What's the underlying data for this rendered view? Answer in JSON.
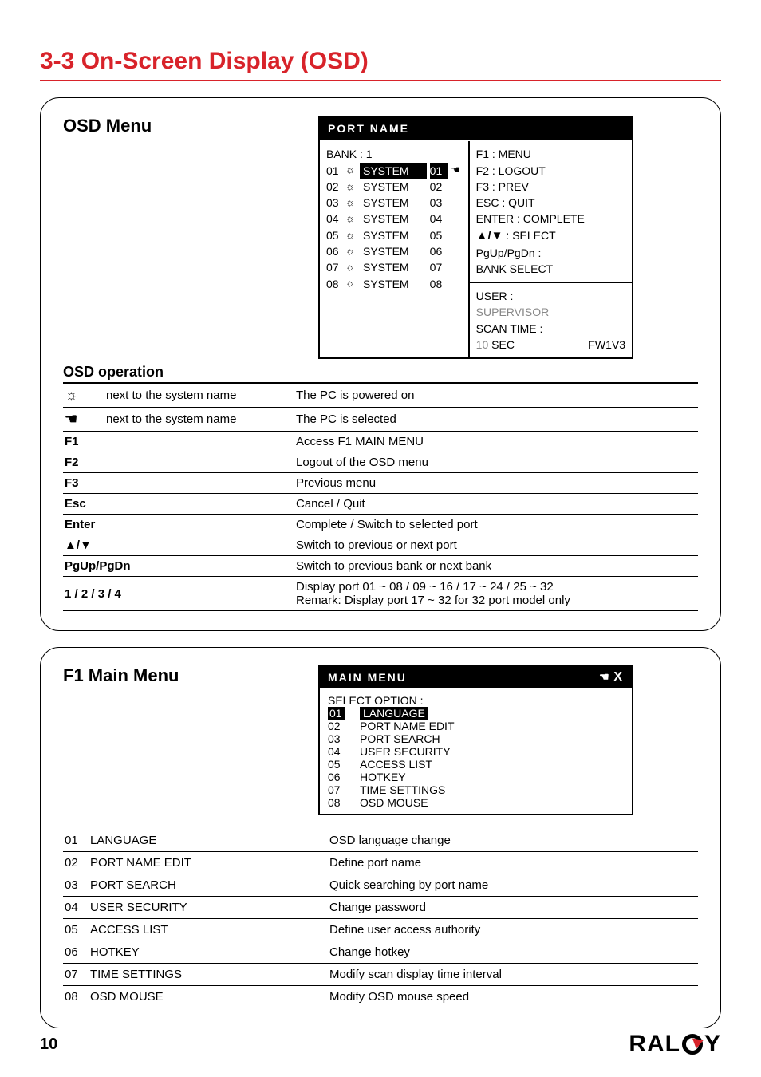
{
  "page": {
    "title": "3-3  On-Screen Display (OSD)",
    "number": "10",
    "brand": "RALOY"
  },
  "card1": {
    "heading": "OSD Menu",
    "subheading": "OSD operation",
    "screen": {
      "title": "PORT  NAME",
      "bank": "BANK : 1",
      "ports": [
        {
          "n": "01",
          "label": "SYSTEM",
          "r": "01",
          "sel": true,
          "hand": true
        },
        {
          "n": "02",
          "label": "SYSTEM",
          "r": "02"
        },
        {
          "n": "03",
          "label": "SYSTEM",
          "r": "03"
        },
        {
          "n": "04",
          "label": "SYSTEM",
          "r": "04"
        },
        {
          "n": "05",
          "label": "SYSTEM",
          "r": "05"
        },
        {
          "n": "06",
          "label": "SYSTEM",
          "r": "06"
        },
        {
          "n": "07",
          "label": "SYSTEM",
          "r": "07"
        },
        {
          "n": "08",
          "label": "SYSTEM",
          "r": "08"
        }
      ],
      "help": [
        "F1 : MENU",
        "F2 : LOGOUT",
        "F3 : PREV",
        "ESC : QUIT",
        "ENTER : COMPLETE",
        "✦/✦ : SELECT",
        "PgUp/PgDn :",
        "BANK SELECT"
      ],
      "help_arrows": "↑/↓ : SELECT",
      "status": {
        "user_label": "USER :",
        "user_value": "SUPERVISOR",
        "scan_label": "SCAN TIME :",
        "scan_value": "10",
        "scan_unit": "SEC",
        "fw": "FW1V3"
      }
    },
    "ops": [
      {
        "key_icon": "☼",
        "key_text": "next to the system name",
        "desc": "The PC is powered on"
      },
      {
        "key_icon": "☚",
        "key_text": "next to the system name",
        "desc": "The PC is selected"
      },
      {
        "key": "F1",
        "desc": "Access F1 MAIN MENU"
      },
      {
        "key": "F2",
        "desc": "Logout of the OSD menu"
      },
      {
        "key": "F3",
        "desc": "Previous menu"
      },
      {
        "key": "Esc",
        "desc": "Cancel / Quit"
      },
      {
        "key": "Enter",
        "desc": "Complete / Switch to selected port"
      },
      {
        "key_arrows": true,
        "desc": "Switch to previous or next port"
      },
      {
        "key": "PgUp/PgDn",
        "desc": "Switch to previous bank or next bank"
      },
      {
        "key": "1 / 2 / 3 / 4",
        "desc": "Display port  01 ~ 08 / 09 ~ 16 / 17 ~ 24 / 25 ~ 32",
        "desc2": "Remark:  Display port 17 ~ 32 for 32 port model only"
      }
    ]
  },
  "card2": {
    "heading": "F1 Main Menu",
    "screen": {
      "title": "MAIN  MENU",
      "select": "SELECT OPTION :",
      "items": [
        {
          "n": "01",
          "label": "LANGUAGE",
          "sel": true
        },
        {
          "n": "02",
          "label": "PORT NAME EDIT"
        },
        {
          "n": "03",
          "label": "PORT SEARCH"
        },
        {
          "n": "04",
          "label": "USER SECURITY"
        },
        {
          "n": "05",
          "label": "ACCESS LIST"
        },
        {
          "n": "06",
          "label": "HOTKEY"
        },
        {
          "n": "07",
          "label": "TIME SETTINGS"
        },
        {
          "n": "08",
          "label": "OSD MOUSE"
        }
      ]
    },
    "ops": [
      {
        "n": "01",
        "name": "LANGUAGE",
        "desc": "OSD language change"
      },
      {
        "n": "02",
        "name": "PORT NAME EDIT",
        "desc": "Define port name"
      },
      {
        "n": "03",
        "name": "PORT SEARCH",
        "desc": "Quick searching by port name"
      },
      {
        "n": "04",
        "name": "USER SECURITY",
        "desc": "Change password"
      },
      {
        "n": "05",
        "name": "ACCESS LIST",
        "desc": "Define user access authority"
      },
      {
        "n": "06",
        "name": "HOTKEY",
        "desc": "Change hotkey"
      },
      {
        "n": "07",
        "name": "TIME SETTINGS",
        "desc": "Modify scan display time interval"
      },
      {
        "n": "08",
        "name": "OSD MOUSE",
        "desc": "Modify OSD mouse speed"
      }
    ]
  }
}
